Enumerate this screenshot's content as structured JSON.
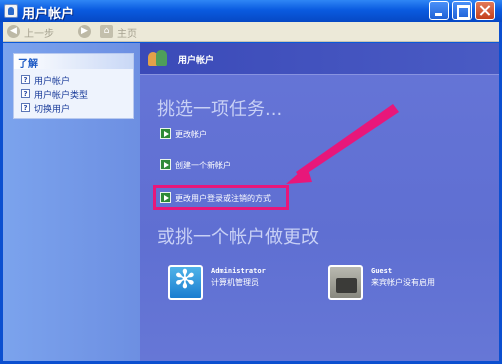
{
  "window": {
    "title": "用户帐户"
  },
  "toolbar": {
    "back_label": "上一步",
    "forward_icon": "forward-arrow-icon",
    "home_label": "主页"
  },
  "sidebar": {
    "learn_title": "了解",
    "items": [
      {
        "label": "用户帐户"
      },
      {
        "label": "用户帐户类型"
      },
      {
        "label": "切换用户"
      }
    ]
  },
  "main": {
    "header_title": "用户帐户",
    "task_heading": "挑选一项任务...",
    "tasks": [
      {
        "label": "更改帐户"
      },
      {
        "label": "创建一个新帐户"
      },
      {
        "label": "更改用户登录或注销的方式"
      }
    ],
    "pick_heading": "或挑一个帐户做更改",
    "accounts": [
      {
        "name": "Administrator",
        "desc": "计算机管理员"
      },
      {
        "name": "Guest",
        "desc": "来宾帐户没有启用"
      }
    ]
  },
  "colors": {
    "highlight": "#e8177a",
    "pane": "#6675d7"
  }
}
